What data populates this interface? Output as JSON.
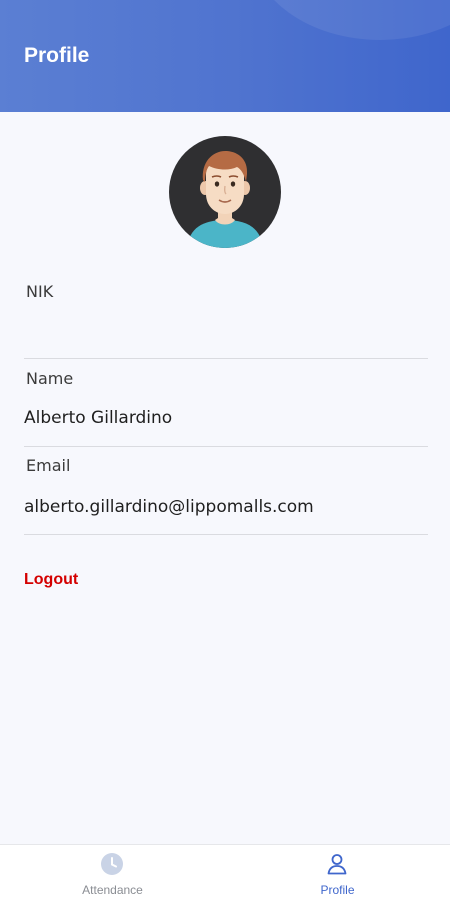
{
  "header": {
    "title": "Profile"
  },
  "profile": {
    "fields": [
      {
        "label": "NIK",
        "value": ""
      },
      {
        "label": "Name",
        "value": "Alberto Gillardino"
      },
      {
        "label": "Email",
        "value": "alberto.gillardino@lippomalls.com"
      }
    ],
    "logout_label": "Logout"
  },
  "bottom_nav": {
    "items": [
      {
        "label": "Attendance",
        "icon": "clock-icon",
        "active": false
      },
      {
        "label": "Profile",
        "icon": "user-icon",
        "active": true
      }
    ]
  },
  "colors": {
    "header": "#4f73cf",
    "accent": "#3f66cc",
    "logout": "#d40000",
    "background": "#f7f8fd",
    "inactive_nav": "#8a8d93"
  }
}
